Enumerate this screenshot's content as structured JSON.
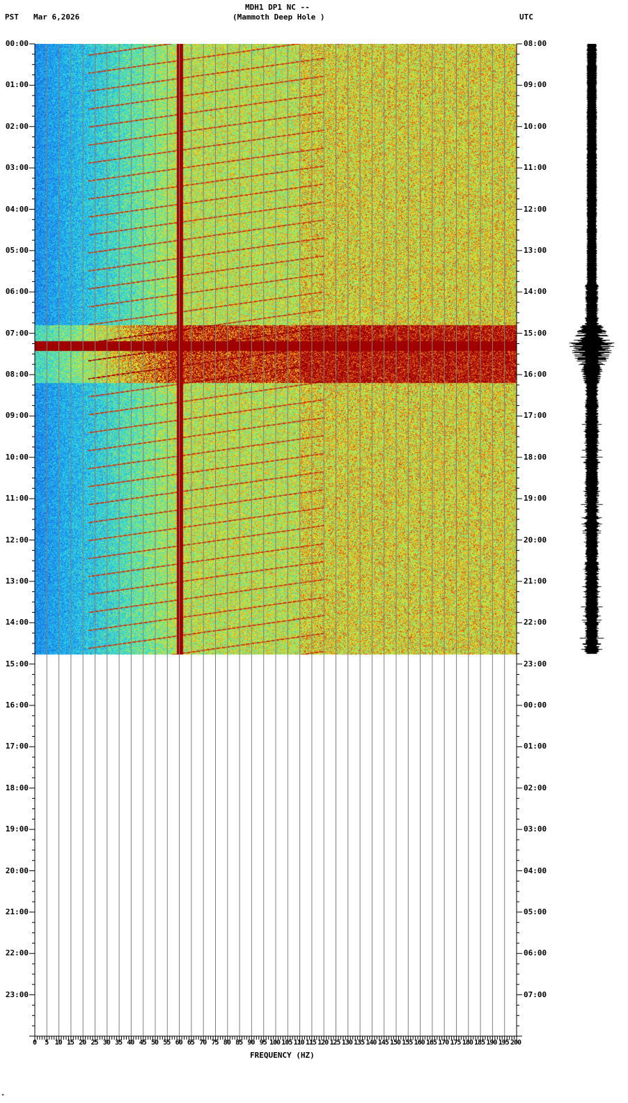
{
  "header": {
    "title": "MDH1 DP1 NC --",
    "subtitle": "(Mammoth Deep Hole )",
    "left_tz": "PST",
    "date": "Mar 6,2026",
    "right_tz": "UTC"
  },
  "footer_mark": "ᴹ",
  "chart_data": {
    "type": "heatmap",
    "title": "MDH1 DP1 NC -- (Mammoth Deep Hole )",
    "xlabel": "FREQUENCY (HZ)",
    "xlim": [
      0,
      200
    ],
    "x_ticks": [
      "0",
      "5",
      "10",
      "15",
      "20",
      "25",
      "30",
      "35",
      "40",
      "45",
      "50",
      "55",
      "60",
      "65",
      "70",
      "75",
      "80",
      "85",
      "90",
      "95",
      "100",
      "105",
      "110",
      "115",
      "120",
      "125",
      "130",
      "135",
      "140",
      "145",
      "150",
      "155",
      "160",
      "165",
      "170",
      "175",
      "180",
      "185",
      "190",
      "195",
      "200"
    ],
    "ylabel_left": "PST",
    "ylabel_right": "UTC",
    "y_ticks_left": [
      "00:00",
      "01:00",
      "02:00",
      "03:00",
      "04:00",
      "05:00",
      "06:00",
      "07:00",
      "08:00",
      "09:00",
      "10:00",
      "11:00",
      "12:00",
      "13:00",
      "14:00",
      "15:00",
      "16:00",
      "17:00",
      "18:00",
      "19:00",
      "20:00",
      "21:00",
      "22:00",
      "23:00"
    ],
    "y_ticks_right": [
      "08:00",
      "09:00",
      "10:00",
      "11:00",
      "12:00",
      "13:00",
      "14:00",
      "15:00",
      "16:00",
      "17:00",
      "18:00",
      "19:00",
      "20:00",
      "21:00",
      "22:00",
      "23:00",
      "00:00",
      "01:00",
      "02:00",
      "03:00",
      "04:00",
      "05:00",
      "06:00",
      "07:00"
    ],
    "data_end_hour_pst": 14.75,
    "persistent_line_hz": 60,
    "event_band_hours_pst": [
      6.8,
      8.2
    ],
    "colors": {
      "low": "#1a5fd0",
      "mid": "#2fe0e0",
      "high": "#f0e020",
      "peak": "#a00000",
      "grid": "#808080"
    }
  }
}
